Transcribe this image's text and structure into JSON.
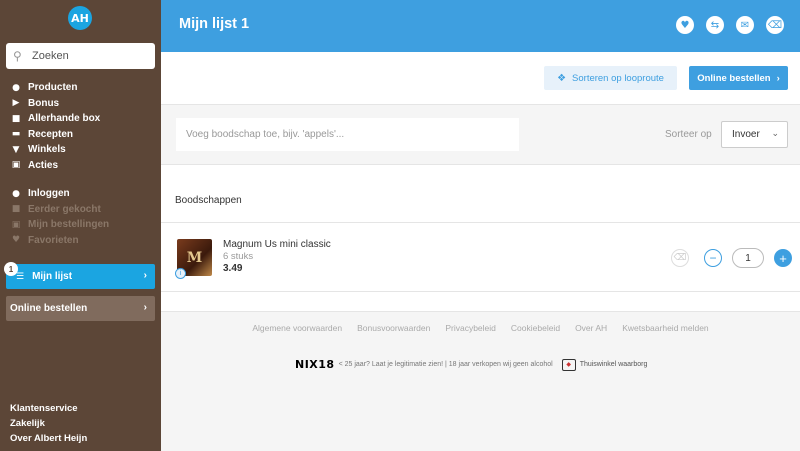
{
  "sidebar": {
    "logo": "AH",
    "search_placeholder": "Zoeken",
    "main_nav": [
      {
        "label": "Producten",
        "icon": "apple-icon"
      },
      {
        "label": "Bonus",
        "icon": "tag-icon"
      },
      {
        "label": "Allerhande box",
        "icon": "box-icon"
      },
      {
        "label": "Recepten",
        "icon": "dish-icon"
      },
      {
        "label": "Winkels",
        "icon": "pin-icon"
      },
      {
        "label": "Acties",
        "icon": "speech-icon"
      }
    ],
    "account_nav": [
      {
        "label": "Inloggen",
        "icon": "user-icon",
        "enabled": true
      },
      {
        "label": "Eerder gekocht",
        "icon": "bag-icon",
        "enabled": false
      },
      {
        "label": "Mijn bestellingen",
        "icon": "orders-icon",
        "enabled": false
      },
      {
        "label": "Favorieten",
        "icon": "heart-icon",
        "enabled": false
      }
    ],
    "list_badge": "1",
    "mijn_lijst": "Mijn lijst",
    "online_bestellen": "Online bestellen",
    "footer_nav": [
      "Klantenservice",
      "Zakelijk",
      "Over Albert Heijn"
    ]
  },
  "header": {
    "title": "Mijn lijst 1",
    "actions": [
      "heart-icon",
      "share-icon",
      "mail-icon",
      "trash-icon"
    ]
  },
  "toolbar": {
    "sort_route": "Sorteren op looproute",
    "online_order": "Online bestellen"
  },
  "add": {
    "placeholder": "Voeg boodschap toe, bijv. 'appels'...",
    "sort_label": "Sorteer op",
    "sort_value": "Invoer"
  },
  "section": {
    "title": "Boodschappen"
  },
  "product": {
    "name": "Magnum Us mini classic",
    "quantity_desc": "6 stuks",
    "price": "3.49",
    "count": "1"
  },
  "footer": {
    "links": [
      "Algemene voorwaarden",
      "Bonusvoorwaarden",
      "Privacybeleid",
      "Cookiebeleid",
      "Over AH",
      "Kwetsbaarheid melden"
    ],
    "nix_logo": "NIX18",
    "legal": "< 25 jaar? Laat je legitimatie zien! | 18 jaar verkopen wij geen alcohol",
    "waarborg": "Thuiswinkel waarborg"
  },
  "colors": {
    "sidebar_bg": "#5c4637",
    "accent": "#3e9fe0",
    "online_bg": "#806b5d"
  }
}
